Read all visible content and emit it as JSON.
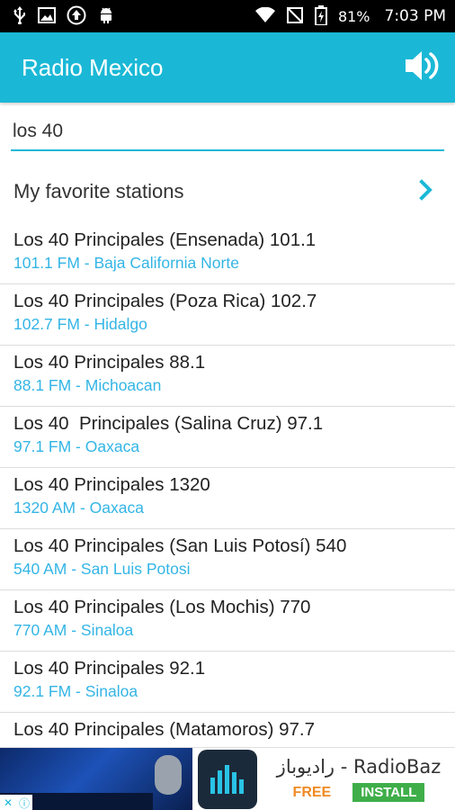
{
  "status_bar": {
    "icons_left": [
      "usb-icon",
      "image-icon",
      "upload-icon",
      "android-icon"
    ],
    "icons_right": [
      "wifi-icon",
      "no-signal-icon",
      "battery-icon"
    ],
    "battery": "81%",
    "time": "7:03 PM"
  },
  "app_bar": {
    "title": "Radio Mexico",
    "action_icon": "volume-icon"
  },
  "search": {
    "value": "los 40"
  },
  "favorites": {
    "label": "My favorite stations",
    "icon": "chevron-right-icon"
  },
  "stations": [
    {
      "name": "Los 40 Principales (Ensenada) 101.1",
      "sub": "101.1 FM - Baja California Norte"
    },
    {
      "name": "Los 40 Principales (Poza Rica) 102.7",
      "sub": "102.7 FM - Hidalgo"
    },
    {
      "name": "Los 40 Principales 88.1",
      "sub": "88.1 FM - Michoacan"
    },
    {
      "name": "Los 40  Principales (Salina Cruz) 97.1",
      "sub": "97.1 FM - Oaxaca"
    },
    {
      "name": "Los 40 Principales 1320",
      "sub": "1320 AM - Oaxaca"
    },
    {
      "name": "Los 40 Principales (San Luis Potosí) 540",
      "sub": "540 AM - San Luis Potosi"
    },
    {
      "name": "Los 40 Principales (Los Mochis) 770",
      "sub": "770 AM - Sinaloa"
    },
    {
      "name": "Los 40 Principales 92.1",
      "sub": "92.1 FM - Sinaloa"
    },
    {
      "name": "Los 40 Principales (Matamoros) 97.7",
      "sub": ""
    }
  ],
  "ad": {
    "title": "راديوباز - RadioBaz",
    "free_label": "FREE",
    "install_label": "INSTALL",
    "close_glyph": "✕",
    "info_glyph": "ⓘ"
  },
  "colors": {
    "accent": "#1ab8d6",
    "subtitle": "#33b5e5"
  }
}
